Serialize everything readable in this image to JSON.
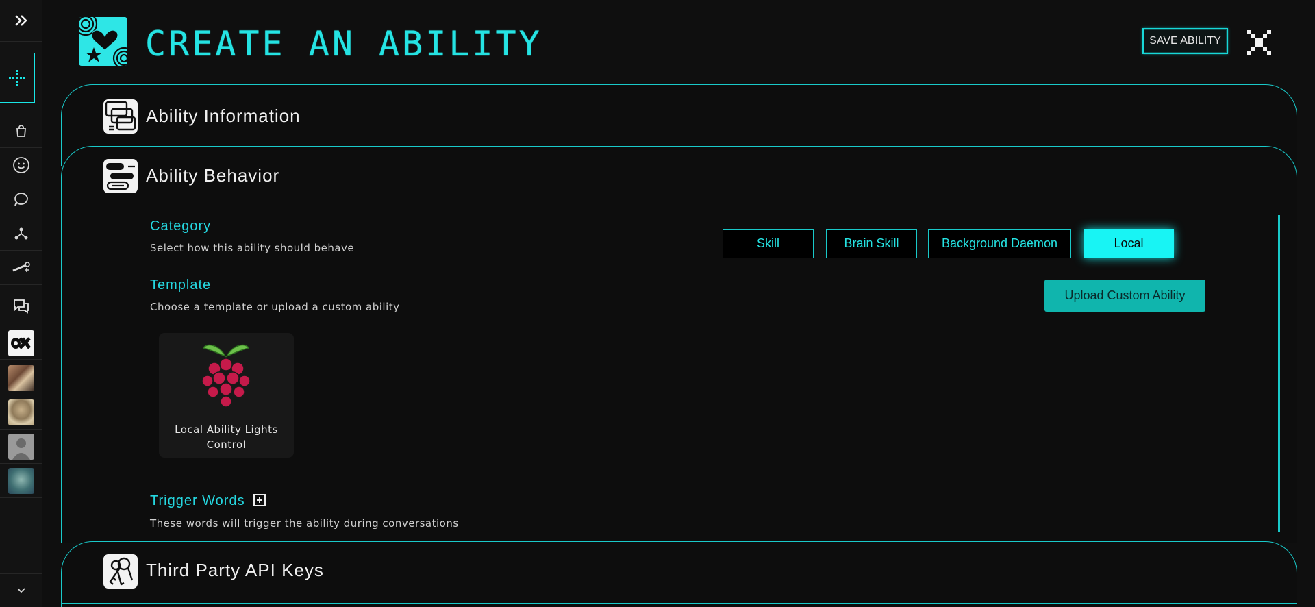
{
  "header": {
    "title": "CREATE AN ABILITY",
    "save_label": "SAVE ABILITY"
  },
  "sections": {
    "ability_information": "Ability Information",
    "ability_behavior": "Ability Behavior",
    "third_party": "Third Party API Keys"
  },
  "category": {
    "label": "Category",
    "description": "Select how this ability should behave",
    "options": [
      "Skill",
      "Brain Skill",
      "Background Daemon",
      "Local"
    ],
    "selected": "Local"
  },
  "template": {
    "label": "Template",
    "description": "Choose a template or upload a custom ability",
    "upload_label": "Upload Custom Ability",
    "cards": [
      {
        "name_line1": "Local Ability Lights",
        "name_line2": "Control",
        "icon": "raspberry-pi-icon"
      }
    ]
  },
  "trigger_words": {
    "label": "Trigger Words",
    "description": "These words will trigger the ability during conversations"
  },
  "sidebar": {
    "icons": [
      "expand-icon",
      "add-icon",
      "shopping-bag-icon",
      "smiley-icon",
      "chat-bubble-icon",
      "network-icon",
      "tools-icon",
      "messages-icon",
      "avatar-ok",
      "avatar-photo-1",
      "avatar-photo-2",
      "avatar-placeholder",
      "avatar-alien"
    ]
  },
  "colors": {
    "accent": "#19e6e6",
    "upload_button": "#10b5ad",
    "background": "#0f0f0f"
  }
}
